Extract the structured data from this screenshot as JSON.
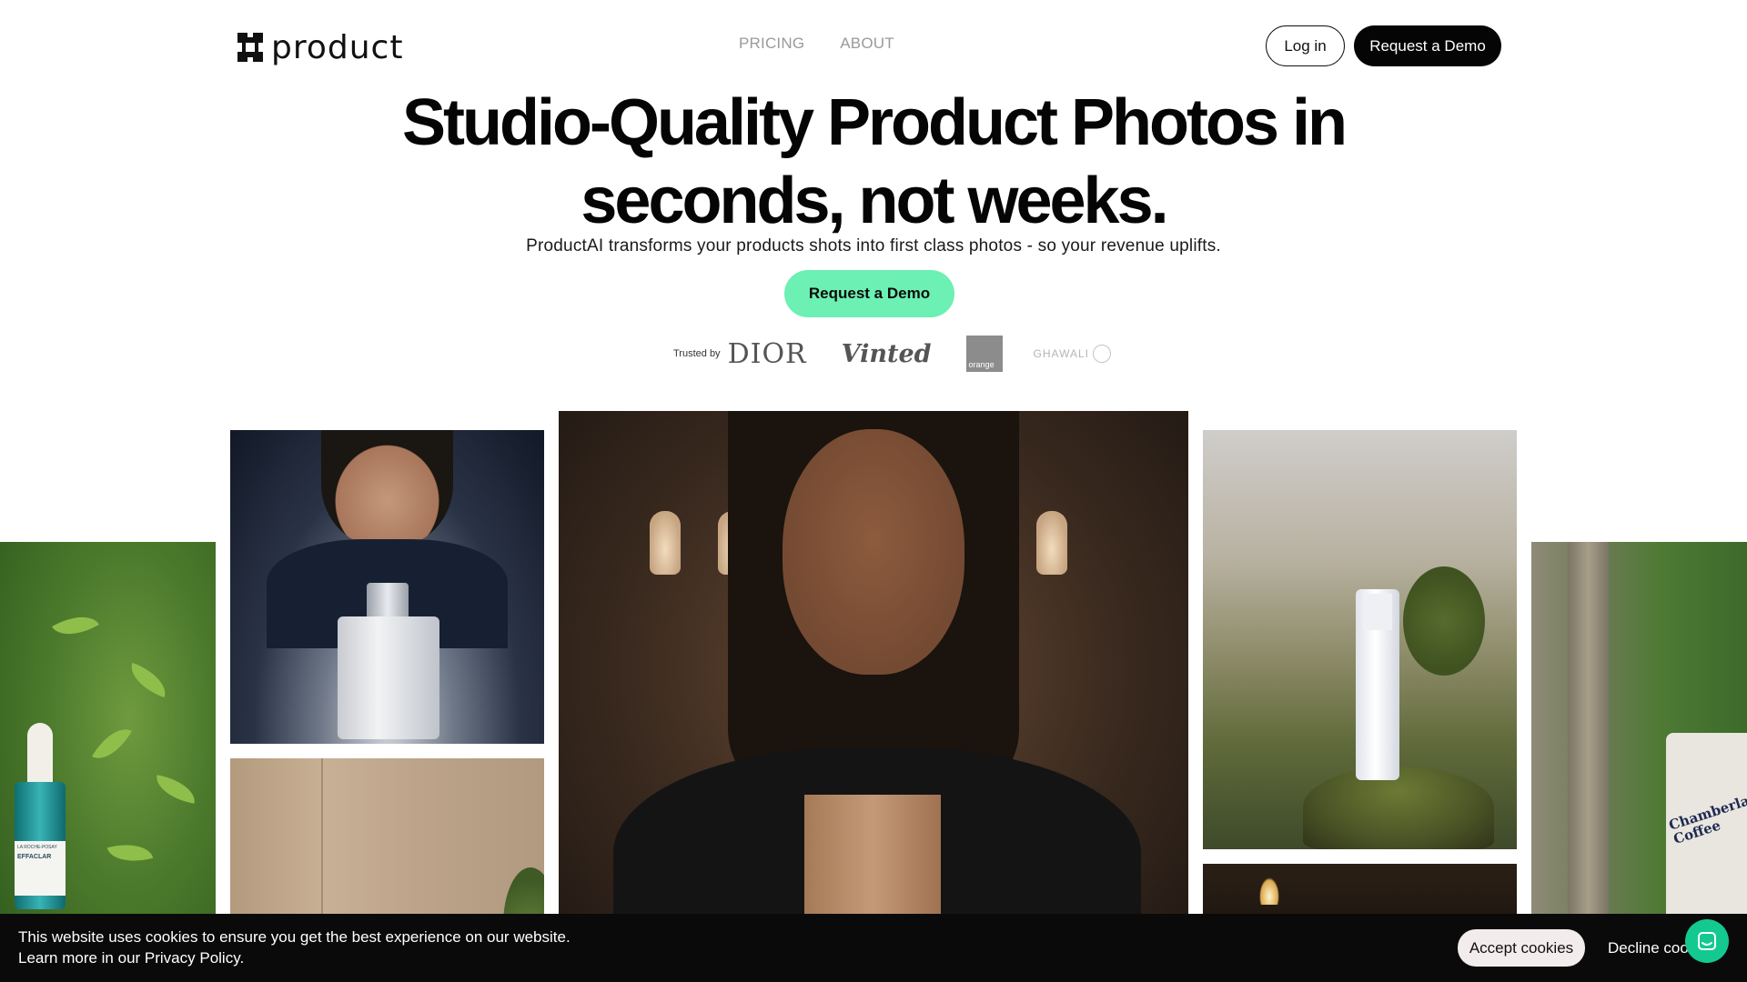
{
  "nav": {
    "logo_text": "product",
    "links": [
      "PRICING",
      "ABOUT"
    ],
    "login_label": "Log in",
    "demo_label": "Request a Demo"
  },
  "hero": {
    "title_line1": "Studio-Quality Product Photos in",
    "title_line2": "seconds, not weeks.",
    "subtitle": "ProductAI transforms your products shots into first class photos - so your revenue uplifts.",
    "cta_label": "Request a Demo"
  },
  "trusted": {
    "label": "Trusted by",
    "brands": {
      "dior": "DIOR",
      "vinted": "Vinted",
      "orange": "orange",
      "ghawali": "GHAWALI"
    }
  },
  "gallery": {
    "serum_brand": "LA ROCHE-POSAY",
    "serum_name": "EFFACLAR",
    "coffee_brand": "Chamberlain Coffee"
  },
  "cookie": {
    "line1": "This website uses cookies to ensure you get the best experience on our website.",
    "line2": "Learn more in our Privacy Policy.",
    "accept_label": "Accept cookies",
    "decline_label": "Decline cookies"
  },
  "colors": {
    "accent": "#6cf0b3",
    "dark": "#050505",
    "chat": "#14c98f"
  },
  "icons": {
    "logo": "product-logo-icon",
    "chat": "chat-icon"
  }
}
